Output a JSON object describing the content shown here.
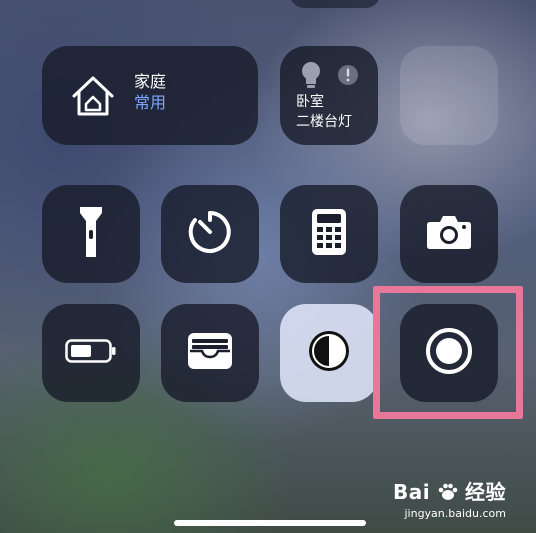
{
  "home": {
    "title": "家庭",
    "subtitle": "常用"
  },
  "accessory": {
    "room": "卧室",
    "name": "二楼台灯"
  },
  "controls": {
    "flashlight": "flashlight-icon",
    "timer": "timer-icon",
    "calculator": "calculator-icon",
    "camera": "camera-icon",
    "low_power_mode": "battery-icon",
    "wallet": "wallet-icon",
    "dark_mode": "dark-mode-icon",
    "screen_recording": "screen-record-icon"
  },
  "colors": {
    "home_subtitle": "#7da6ff",
    "highlight_box": "#e8779a"
  },
  "watermark": {
    "brand": "Bai",
    "brand_suffix": "经验",
    "url": "jingyan.baidu.com"
  }
}
